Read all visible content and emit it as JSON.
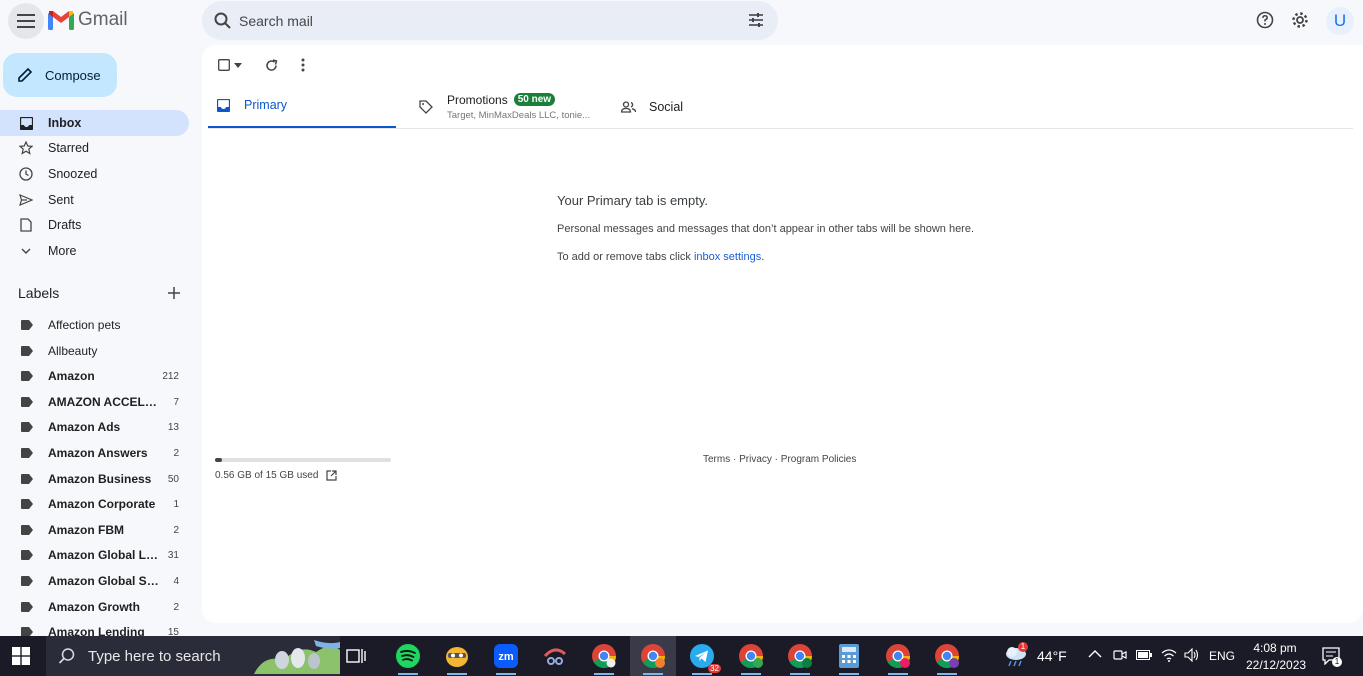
{
  "header": {
    "app_name": "Gmail",
    "search_placeholder": "Search mail",
    "avatar_letter": "U"
  },
  "compose_label": "Compose",
  "nav": [
    {
      "label": "Inbox",
      "icon": "inbox-icon",
      "active": true
    },
    {
      "label": "Starred",
      "icon": "star-icon"
    },
    {
      "label": "Snoozed",
      "icon": "clock-icon"
    },
    {
      "label": "Sent",
      "icon": "send-icon"
    },
    {
      "label": "Drafts",
      "icon": "draft-icon"
    },
    {
      "label": "More",
      "icon": "chevron-down-icon"
    }
  ],
  "labels_title": "Labels",
  "labels": [
    {
      "name": "Affection pets",
      "count": ""
    },
    {
      "name": "Allbeauty",
      "count": ""
    },
    {
      "name": "Amazon",
      "count": "212"
    },
    {
      "name": "AMAZON ACCELER...",
      "count": "7"
    },
    {
      "name": "Amazon Ads",
      "count": "13"
    },
    {
      "name": "Amazon Answers",
      "count": "2"
    },
    {
      "name": "Amazon Business",
      "count": "50"
    },
    {
      "name": "Amazon Corporate",
      "count": "1"
    },
    {
      "name": "Amazon FBM",
      "count": "2"
    },
    {
      "name": "Amazon Global Lo...",
      "count": "31"
    },
    {
      "name": "Amazon Global Sell...",
      "count": "4"
    },
    {
      "name": "Amazon Growth",
      "count": "2"
    },
    {
      "name": "Amazon Lending",
      "count": "15"
    }
  ],
  "tabs": {
    "primary": "Primary",
    "promotions": "Promotions",
    "promotions_badge": "50 new",
    "promotions_sub": "Target, MinMaxDeals LLC, tonie...",
    "social": "Social"
  },
  "empty": {
    "title": "Your Primary tab is empty.",
    "desc": "Personal messages and messages that don’t appear in other tabs will be shown here.",
    "hint_prefix": "To add or remove tabs click ",
    "hint_link": "inbox settings",
    "hint_suffix": "."
  },
  "storage": {
    "text": "0.56 GB of 15 GB used",
    "used_fraction": 0.037
  },
  "footer": "Terms · Privacy · Program Policies",
  "taskbar": {
    "search_placeholder": "Type here to search",
    "telegram_badge": "32",
    "weather_badge": "1",
    "temperature": "44°F",
    "language": "ENG",
    "time": "4:08 pm",
    "date": "22/12/2023",
    "notif_count": "1",
    "chrome_profiles": [
      "M",
      "M",
      "L",
      "S",
      "R"
    ]
  },
  "colors": {
    "accent": "#0b57d0",
    "compose_bg": "#c2e7ff",
    "active_nav": "#d3e3fd",
    "badge_green": "#188038"
  }
}
